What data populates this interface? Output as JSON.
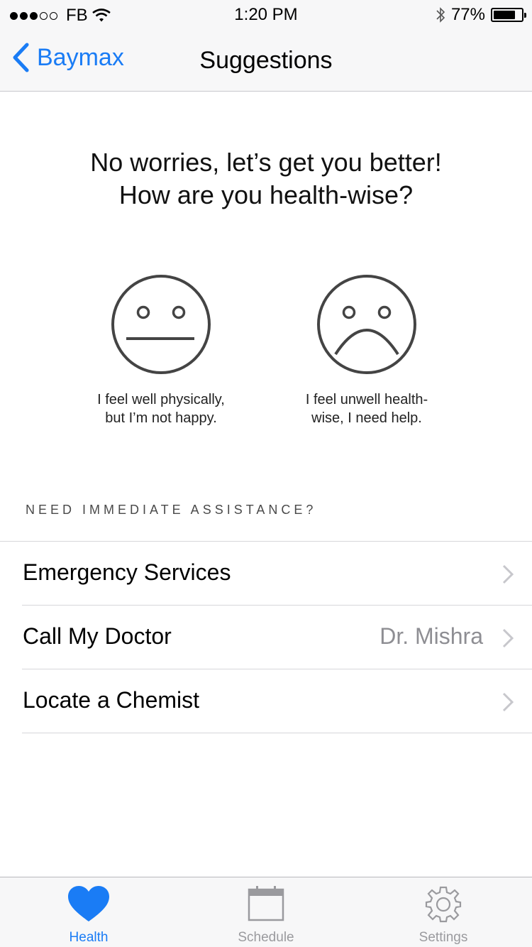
{
  "status_bar": {
    "carrier": "FB",
    "time": "1:20 PM",
    "battery_percent": "77%",
    "signal_filled": 3,
    "signal_total": 5
  },
  "nav": {
    "back_label": "Baymax",
    "title": "Suggestions"
  },
  "prompt": {
    "line1": "No worries, let’s get you better!",
    "line2": "How are you health-wise?"
  },
  "options": [
    {
      "icon": "neutral-face-icon",
      "line1": "I feel well physically,",
      "line2": "but I’m not happy."
    },
    {
      "icon": "sad-face-icon",
      "line1": "I feel unwell health-",
      "line2": "wise, I need help."
    }
  ],
  "assistance": {
    "header": "NEED IMMEDIATE ASSISTANCE?",
    "items": [
      {
        "label": "Emergency Services",
        "detail": ""
      },
      {
        "label": "Call My Doctor",
        "detail": "Dr. Mishra"
      },
      {
        "label": "Locate a Chemist",
        "detail": ""
      }
    ]
  },
  "tabbar": {
    "tabs": [
      {
        "label": "Health",
        "icon": "heart-icon",
        "active": true
      },
      {
        "label": "Schedule",
        "icon": "calendar-icon",
        "active": false
      },
      {
        "label": "Settings",
        "icon": "gear-icon",
        "active": false
      }
    ]
  },
  "colors": {
    "accent": "#1a7cf5",
    "inactive": "#9a9a9e",
    "detail_gray": "#8e8e93"
  }
}
